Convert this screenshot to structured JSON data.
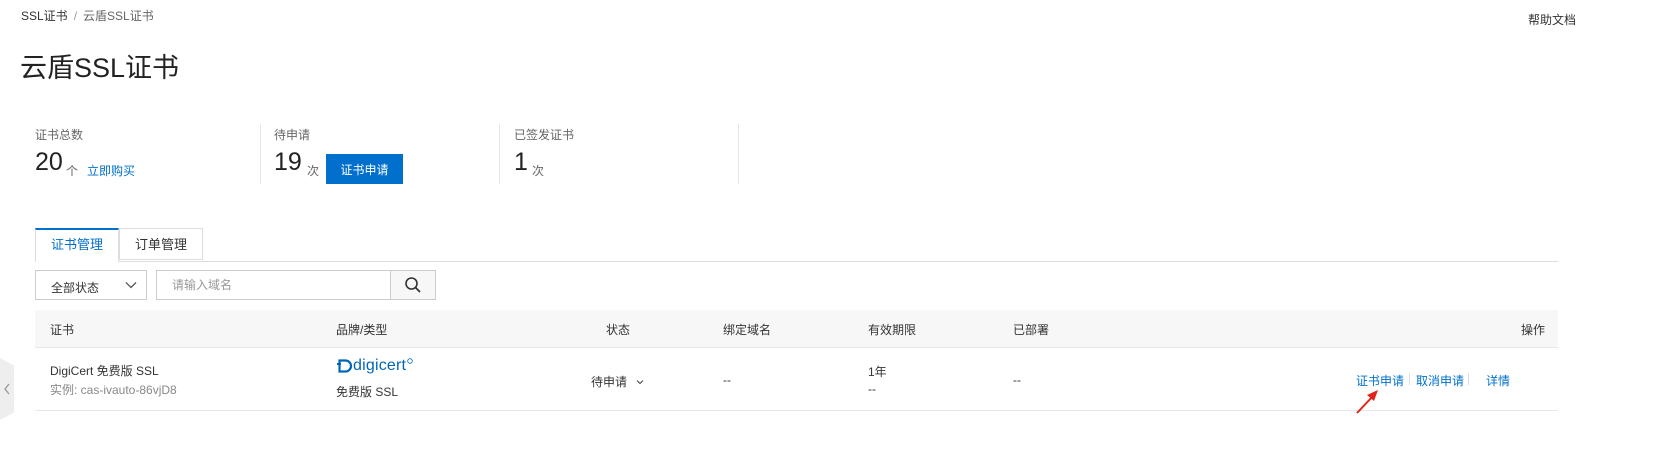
{
  "header": {
    "breadcrumb": [
      "SSL证书",
      "云盾SSL证书"
    ],
    "breadcrumb_sep": "/",
    "help_label": "帮助文档",
    "page_title": "云盾SSL证书"
  },
  "stats": [
    {
      "label": "证书总数",
      "value": "20",
      "unit": "个",
      "link": "立即购买"
    },
    {
      "label": "待申请",
      "value": "19",
      "unit": "次",
      "button": "证书申请"
    },
    {
      "label": "已签发证书",
      "value": "1",
      "unit": "次"
    }
  ],
  "tabs": [
    {
      "label": "证书管理",
      "active": true
    },
    {
      "label": "订单管理",
      "active": false
    }
  ],
  "filter": {
    "status_select": "全部状态",
    "search_placeholder": "请输入域名"
  },
  "table": {
    "columns": [
      "证书",
      "品牌/类型",
      "状态",
      "绑定域名",
      "有效期限",
      "已部署",
      "操作"
    ],
    "rows": [
      {
        "cert_name": "DigiCert 免费版 SSL",
        "instance": "实例: cas-ivauto-86vjD8",
        "brand": "digicert",
        "type": "免费版 SSL",
        "status": "待申请",
        "domain": "--",
        "validity": "1年",
        "validity_sub": "--",
        "deployed": "--",
        "actions": [
          "证书申请",
          "取消申请",
          "详情"
        ]
      }
    ]
  },
  "colors": {
    "accent": "#0070cc",
    "annotation_arrow": "#e0241b"
  }
}
